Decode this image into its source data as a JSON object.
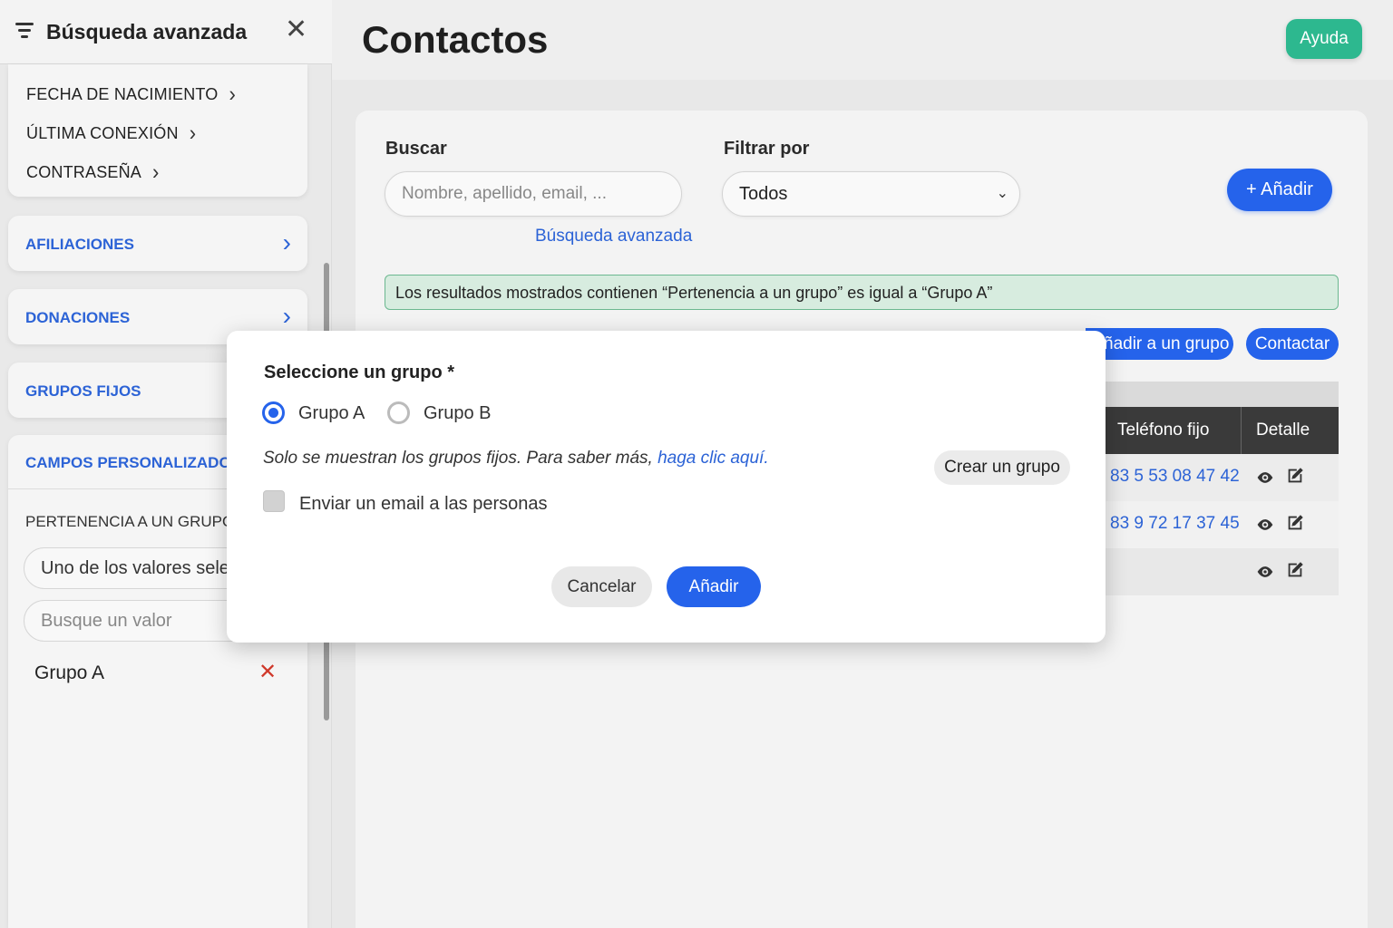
{
  "sidebar": {
    "title": "Búsqueda avanzada",
    "close_icon": "close-icon",
    "filter_icon": "filter-icon",
    "sub_items": [
      {
        "label": "FECHA DE NACIMIENTO"
      },
      {
        "label": "ÚLTIMA CONEXIÓN"
      },
      {
        "label": "CONTRASEÑA"
      }
    ],
    "sections": [
      {
        "label": "AFILIACIONES"
      },
      {
        "label": "DONACIONES"
      },
      {
        "label": "GRUPOS FIJOS"
      }
    ],
    "custom": {
      "label": "CAMPOS PERSONALIZADOS",
      "field_label": "PERTENENCIA A UN GRUPO",
      "operator_value": "Uno de los valores selec.",
      "search_placeholder": "Busque un valor",
      "selected_value": "Grupo A"
    }
  },
  "header": {
    "title": "Contactos",
    "help_label": "Ayuda"
  },
  "filters": {
    "search_label": "Buscar",
    "search_placeholder": "Nombre, apellido, email, ...",
    "advanced_link": "Búsqueda avanzada",
    "filter_label": "Filtrar por",
    "filter_value": "Todos",
    "add_label": "+ Añadir"
  },
  "banner": {
    "text": "Los resultados mostrados contienen “Pertenencia a un grupo” es igual a “Grupo A”"
  },
  "actions": {
    "add_to_group": "ñadir a un grupo",
    "contact": "Contactar"
  },
  "table": {
    "headers": [
      "Teléfono fijo",
      "Detalle"
    ],
    "rows": [
      {
        "phone": "83 5 53 08 47 42"
      },
      {
        "phone": "83 9 72 17 37 45"
      },
      {
        "phone": ""
      }
    ]
  },
  "modal": {
    "title": "Seleccione un grupo *",
    "options": [
      {
        "label": "Grupo A",
        "checked": true
      },
      {
        "label": "Grupo B",
        "checked": false
      }
    ],
    "note": "Solo se muestran los grupos fijos. Para saber más, ",
    "note_link": "haga clic aquí.",
    "create_group": "Crear un grupo",
    "email_checkbox": "Enviar un email a las personas",
    "cancel": "Cancelar",
    "confirm": "Añadir"
  },
  "colors": {
    "accent": "#2563eb",
    "help": "#2db88f",
    "banner_bg": "#d7ecdf",
    "delete": "#d0392b"
  }
}
